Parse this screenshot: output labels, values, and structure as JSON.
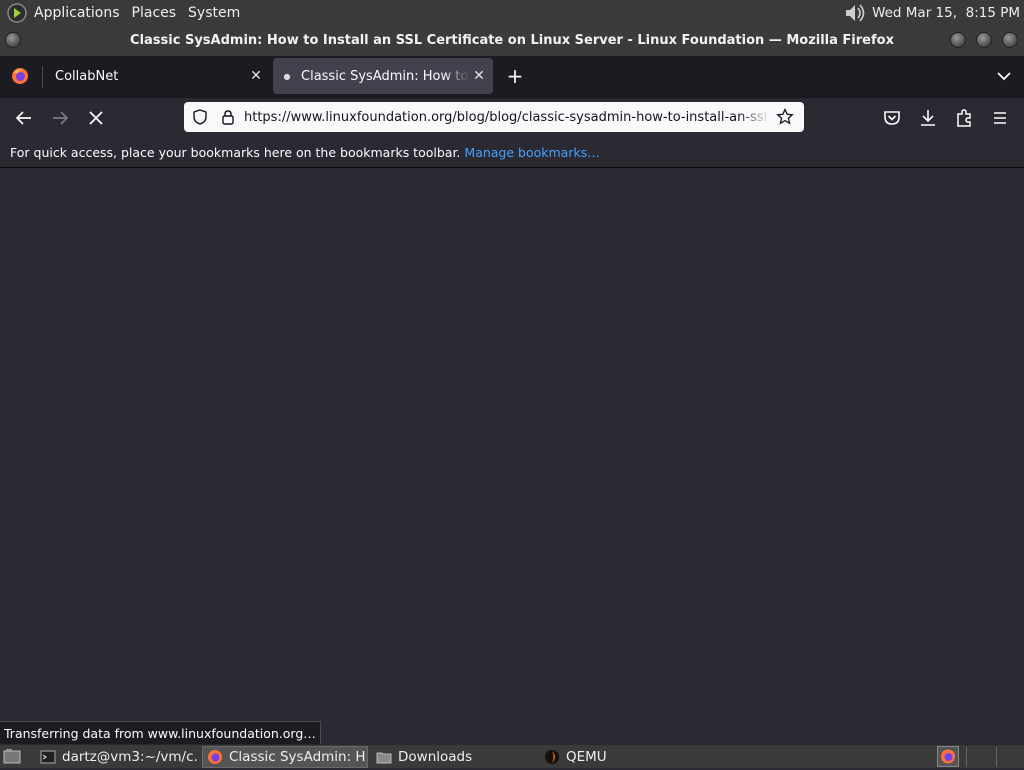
{
  "top_panel": {
    "menus": [
      "Applications",
      "Places",
      "System"
    ],
    "clock": "Wed Mar 15,  8:15 PM",
    "volume_icon": "speaker-icon"
  },
  "window": {
    "title": "Classic SysAdmin: How to Install an SSL Certificate on Linux Server - Linux Foundation — Mozilla Firefox"
  },
  "tabs": [
    {
      "label": "CollabNet",
      "active": false
    },
    {
      "label": "Classic SysAdmin: How to Install an SSL Certificate on Linux Server",
      "active": true,
      "loading": true
    }
  ],
  "urlbar": {
    "url": "https://www.linuxfoundation.org/blog/blog/classic-sysadmin-how-to-install-an-ssl-certificate-on-linux-server"
  },
  "bookmarks_bar": {
    "message": "For quick access, place your bookmarks here on the bookmarks toolbar.",
    "manage_link": "Manage bookmarks…"
  },
  "status": {
    "text": "Transferring data from www.linuxfoundation.org…"
  },
  "taskbar": {
    "items": [
      {
        "label": "dartz@vm3:~/vm/c…",
        "icon": "terminal-icon"
      },
      {
        "label": "Classic SysAdmin: H…",
        "icon": "firefox-icon",
        "active": true
      },
      {
        "label": "Downloads",
        "icon": "folder-icon"
      },
      {
        "label": "QEMU",
        "icon": "qemu-icon"
      }
    ]
  },
  "colors": {
    "toolbar_bg": "#2b2a33",
    "tabstrip_bg": "#1c1b22",
    "active_tab_bg": "#42414d",
    "link": "#45a1ff",
    "panel_bg": "#3a3a3a"
  }
}
